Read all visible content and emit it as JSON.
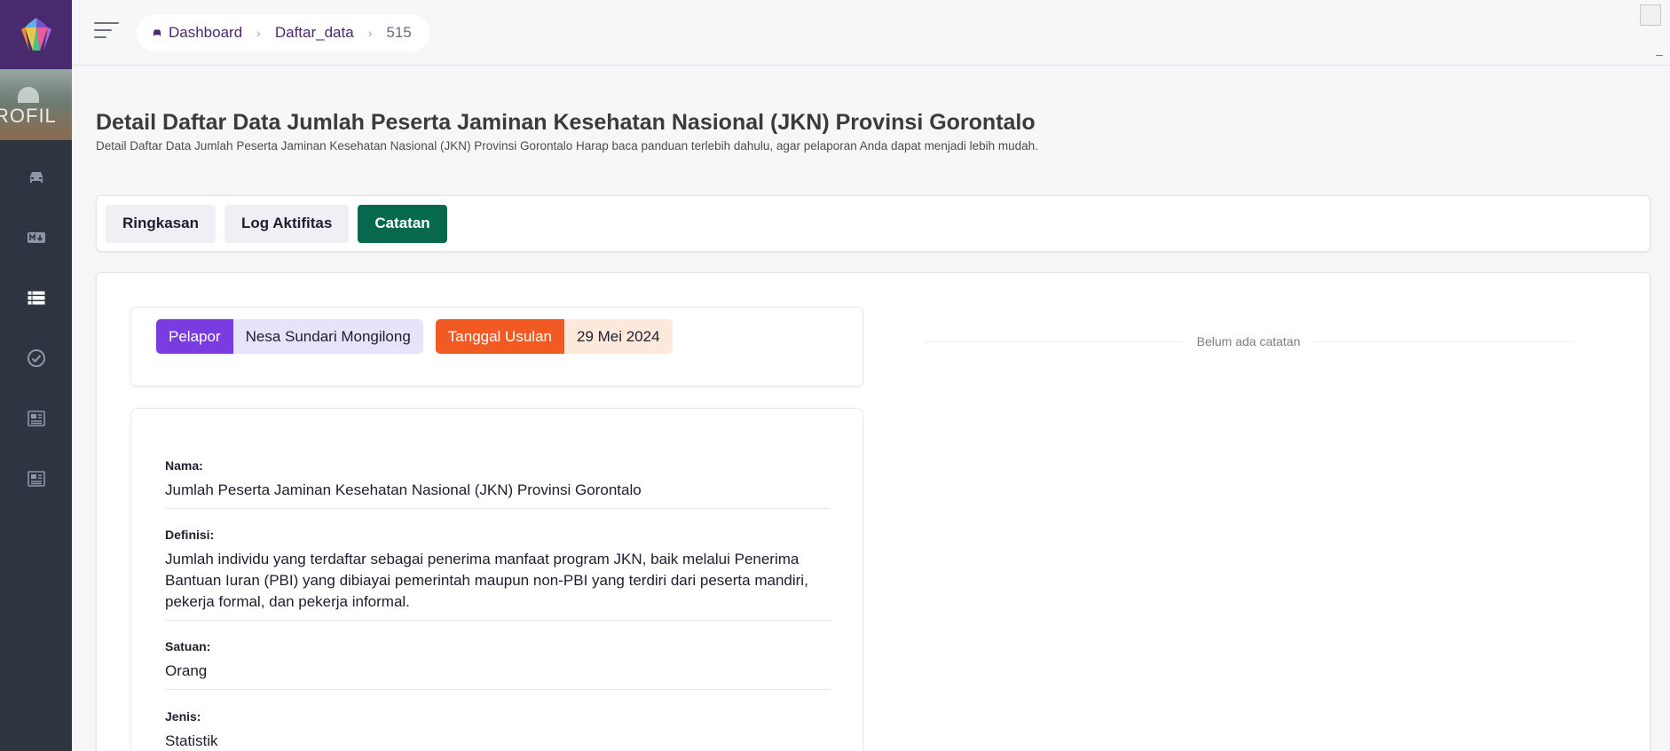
{
  "sidebar": {
    "logo_icon": "gem-logo-icon",
    "profile_text": "ROFIL",
    "items": [
      {
        "icon": "car-icon"
      },
      {
        "icon": "markdown-icon"
      },
      {
        "icon": "list-icon",
        "active": true
      },
      {
        "icon": "check-circle-icon"
      },
      {
        "icon": "newspaper-icon"
      },
      {
        "icon": "newspaper-icon"
      }
    ]
  },
  "breadcrumb": {
    "home": "Dashboard",
    "items": [
      "Daftar_data",
      "515"
    ]
  },
  "page": {
    "title": "Detail Daftar Data Jumlah Peserta Jaminan Kesehatan Nasional (JKN) Provinsi Gorontalo",
    "subtitle": "Detail Daftar Data Jumlah Peserta Jaminan Kesehatan Nasional (JKN) Provinsi Gorontalo Harap baca panduan terlebih dahulu, agar pelaporan Anda dapat menjadi lebih mudah."
  },
  "tabs": [
    {
      "label": "Ringkasan",
      "active": false
    },
    {
      "label": "Log Aktifitas",
      "active": false
    },
    {
      "label": "Catatan",
      "active": true
    }
  ],
  "reporter": {
    "label": "Pelapor",
    "name": "Nesa Sundari Mongilong",
    "date_label": "Tanggal Usulan",
    "date": "29 Mei 2024"
  },
  "details": {
    "nama_label": "Nama:",
    "nama": "Jumlah Peserta Jaminan Kesehatan Nasional (JKN) Provinsi Gorontalo",
    "definisi_label": "Definisi:",
    "definisi_line1": "Jumlah individu yang terdaftar sebagai penerima manfaat program JKN, baik melalui Penerima",
    "definisi_line2": "Bantuan Iuran (PBI) yang dibiayai pemerintah maupun non-PBI yang terdiri dari peserta mandiri,",
    "definisi_line3": "pekerja formal, dan pekerja informal.",
    "satuan_label": "Satuan:",
    "satuan": "Orang",
    "jenis_label": "Jenis:",
    "jenis": "Statistik"
  },
  "notes": {
    "empty_text": "Belum ada catatan"
  },
  "colors": {
    "sidebar": "#2e3440",
    "brand_purple": "#4a2a6e",
    "active_tab": "#06694e",
    "badge_purple": "#7a3ce0",
    "badge_orange": "#f15a22"
  }
}
